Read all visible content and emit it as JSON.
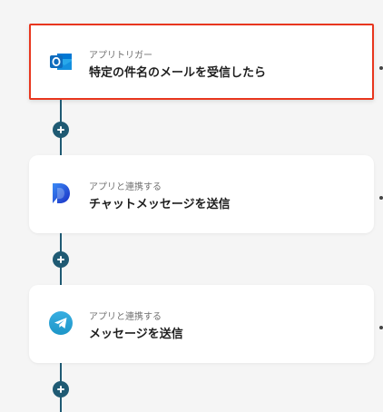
{
  "flow": {
    "steps": [
      {
        "subtitle": "アプリトリガー",
        "title": "特定の件名のメールを受信したら",
        "icon": "outlook-icon",
        "selected": true
      },
      {
        "subtitle": "アプリと連携する",
        "title": "チャットメッセージを送信",
        "icon": "chat-app-icon",
        "selected": false
      },
      {
        "subtitle": "アプリと連携する",
        "title": "メッセージを送信",
        "icon": "telegram-icon",
        "selected": false
      }
    ]
  },
  "colors": {
    "background": "#f5f5f5",
    "selection_border": "#e8361e",
    "connector": "#1f5a73",
    "outlook_blue": "#0f6cbd",
    "chat_blue": "#1f4fd8",
    "telegram_blue": "#2aa1da"
  }
}
